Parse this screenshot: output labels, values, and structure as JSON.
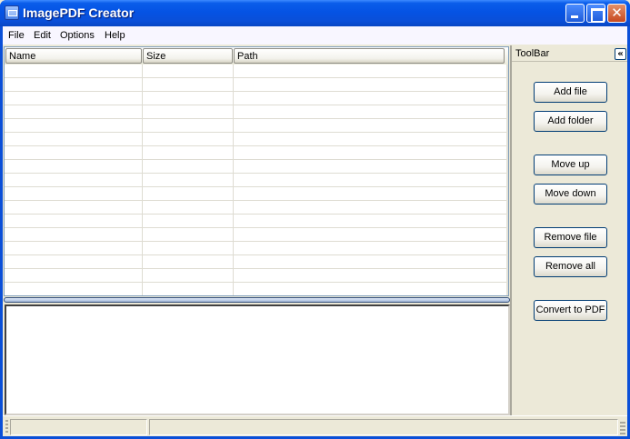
{
  "window": {
    "title": "ImagePDF Creator"
  },
  "menu": {
    "items": [
      "File",
      "Edit",
      "Options",
      "Help"
    ]
  },
  "file_list": {
    "columns": [
      "Name",
      "Size",
      "Path"
    ],
    "rows": []
  },
  "toolbar": {
    "title": "ToolBar",
    "collapse_glyph": "«",
    "buttons": {
      "add_file": "Add file",
      "add_folder": "Add folder",
      "move_up": "Move up",
      "move_down": "Move down",
      "remove_file": "Remove file",
      "remove_all": "Remove all",
      "convert": "Convert to PDF"
    }
  },
  "status": {
    "pane1": "",
    "pane2": ""
  },
  "colors": {
    "titlebar": "#0A4FD8",
    "face": "#ECE9D8",
    "button_border": "#003C74"
  },
  "icons": {
    "app": "app-window-icon",
    "minimize": "minimize-icon",
    "maximize": "maximize-icon",
    "close": "close-icon"
  }
}
